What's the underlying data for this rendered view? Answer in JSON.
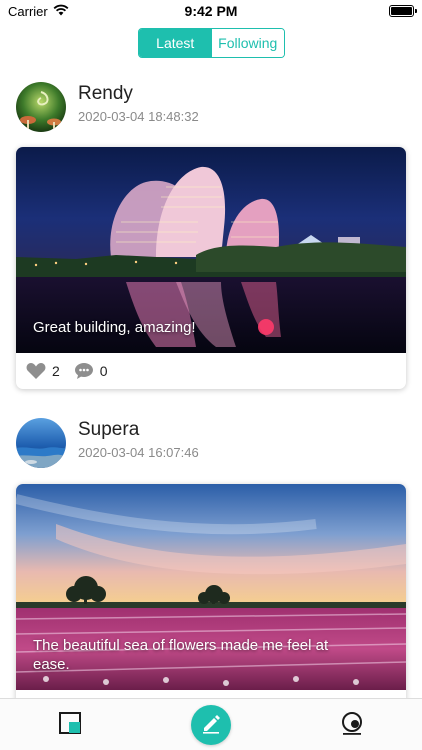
{
  "status_bar": {
    "carrier": "Carrier",
    "time": "9:42 PM",
    "wifi_icon": "wifi-icon",
    "battery_icon": "battery-icon",
    "battery_level": 1.0
  },
  "segmented_control": {
    "options": [
      "Latest",
      "Following"
    ],
    "selected": "Latest",
    "accent_color": "#1ebfae"
  },
  "posts": [
    {
      "author": "Rendy",
      "timestamp": "2020-03-04 18:48:32",
      "caption": "Great building, amazing!",
      "likes": "2",
      "comments": "0",
      "image": "night-city-lake-scene"
    },
    {
      "author": "Supera",
      "timestamp": "2020-03-04 16:07:46",
      "caption": "The beautiful sea of flowers made me feel at ease.",
      "image": "tulip-field-sunset-scene"
    }
  ],
  "tab_bar": {
    "items": [
      {
        "icon": "square-tab-icon",
        "selected": true
      },
      {
        "icon": "compose-pen-icon",
        "selected": false
      },
      {
        "icon": "profile-tab-icon",
        "selected": false
      }
    ],
    "accent_color": "#1ebfae"
  }
}
